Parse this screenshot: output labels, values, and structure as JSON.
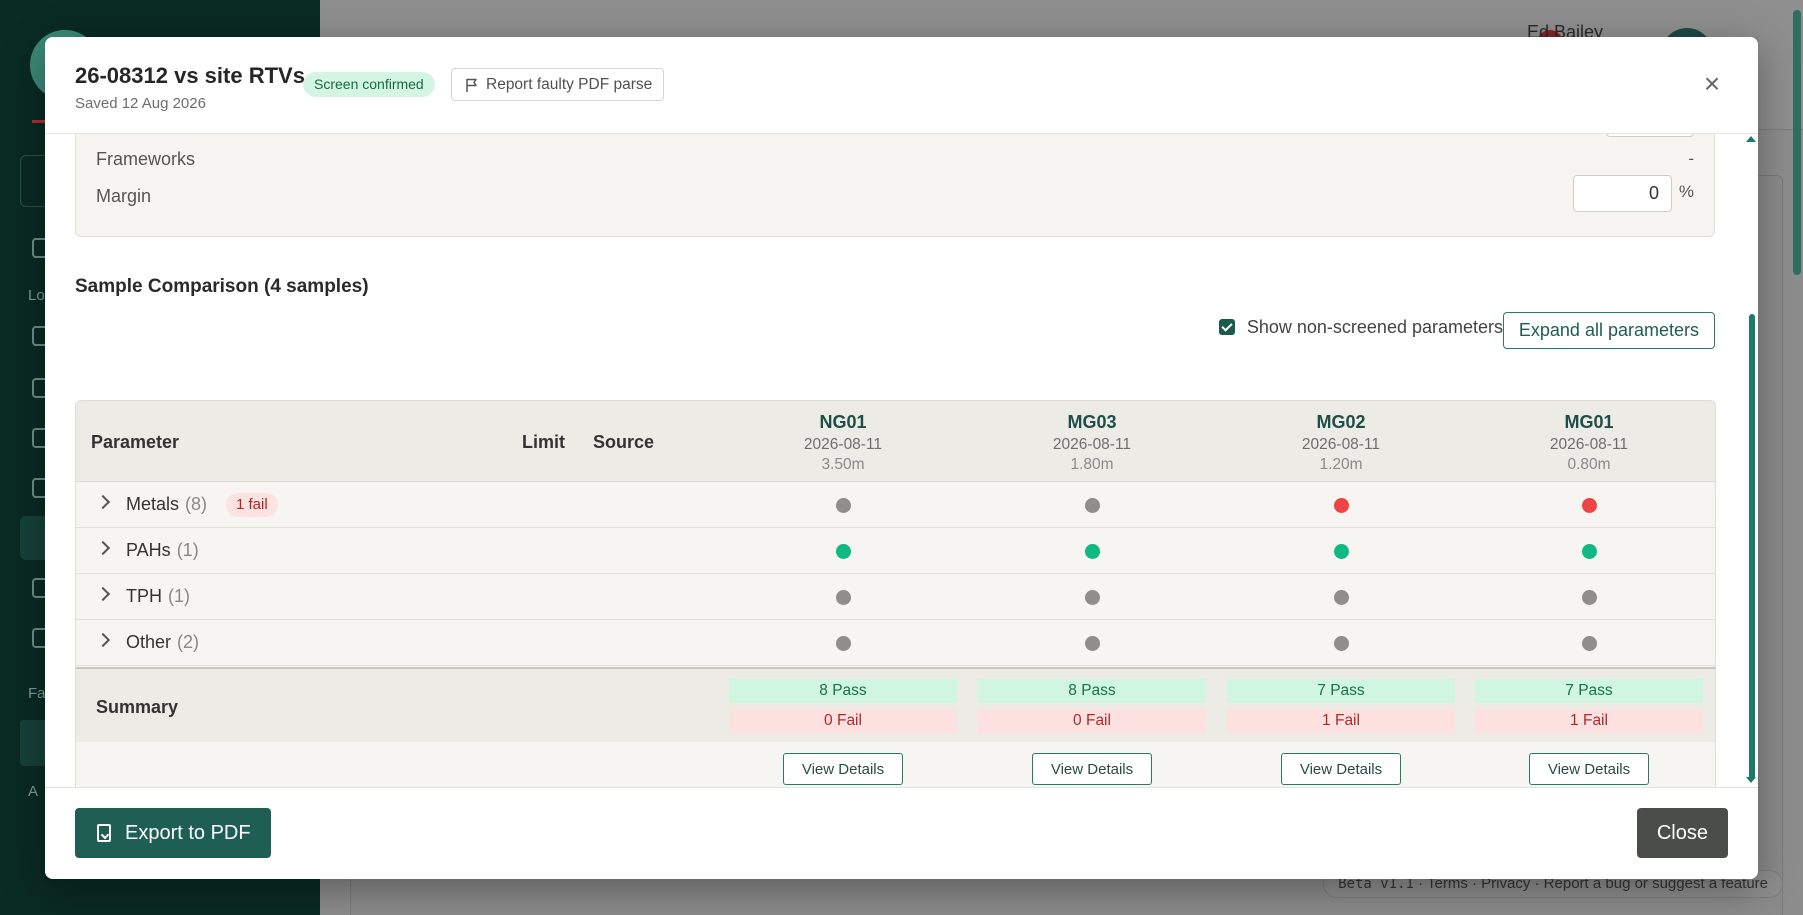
{
  "background": {
    "user_name": "Ed Bailey",
    "footer_version": "Beta v1.1",
    "footer_links": "· Terms · Privacy · Report a bug or suggest a feature"
  },
  "modal": {
    "title": "26-08312 vs site RTVs",
    "subtitle": "Saved 12 Aug 2026",
    "status_badge": "Screen confirmed",
    "report_button": "Report faulty PDF parse",
    "close_symbol": "×"
  },
  "settings": {
    "frameworks_label": "Frameworks",
    "frameworks_value": "-",
    "margin_label": "Margin",
    "margin_value": "0",
    "margin_unit": "%"
  },
  "comparison": {
    "title": "Sample Comparison (4 samples)",
    "show_nonscreened_label": "Show non-screened parameters",
    "show_nonscreened_checked": true,
    "expand_all_label": "Expand all parameters",
    "headers": {
      "parameter": "Parameter",
      "limit": "Limit",
      "source": "Source"
    },
    "samples": [
      {
        "name": "NG01",
        "date": "2026-08-11",
        "depth": "3.50m"
      },
      {
        "name": "MG03",
        "date": "2026-08-11",
        "depth": "1.80m"
      },
      {
        "name": "MG02",
        "date": "2026-08-11",
        "depth": "1.20m"
      },
      {
        "name": "MG01",
        "date": "2026-08-11",
        "depth": "0.80m"
      }
    ],
    "groups": [
      {
        "name": "Metals",
        "count": "(8)",
        "fail_badge": "1 fail",
        "status": [
          "none",
          "none",
          "fail",
          "fail"
        ]
      },
      {
        "name": "PAHs",
        "count": "(1)",
        "fail_badge": "",
        "status": [
          "pass",
          "pass",
          "pass",
          "pass"
        ]
      },
      {
        "name": "TPH",
        "count": "(1)",
        "fail_badge": "",
        "status": [
          "none",
          "none",
          "none",
          "none"
        ]
      },
      {
        "name": "Other",
        "count": "(2)",
        "fail_badge": "",
        "status": [
          "none",
          "none",
          "none",
          "none"
        ]
      }
    ],
    "summary": {
      "label": "Summary",
      "pass": [
        "8 Pass",
        "8 Pass",
        "7 Pass",
        "7 Pass"
      ],
      "fail": [
        "0 Fail",
        "0 Fail",
        "1 Fail",
        "1 Fail"
      ]
    },
    "view_details_label": "View Details"
  },
  "footer": {
    "export_label": "Export to PDF",
    "close_label": "Close"
  },
  "colors": {
    "pass": "#10b981",
    "fail": "#ef4444",
    "none": "#8f8e89",
    "accent": "#1f5e52"
  }
}
